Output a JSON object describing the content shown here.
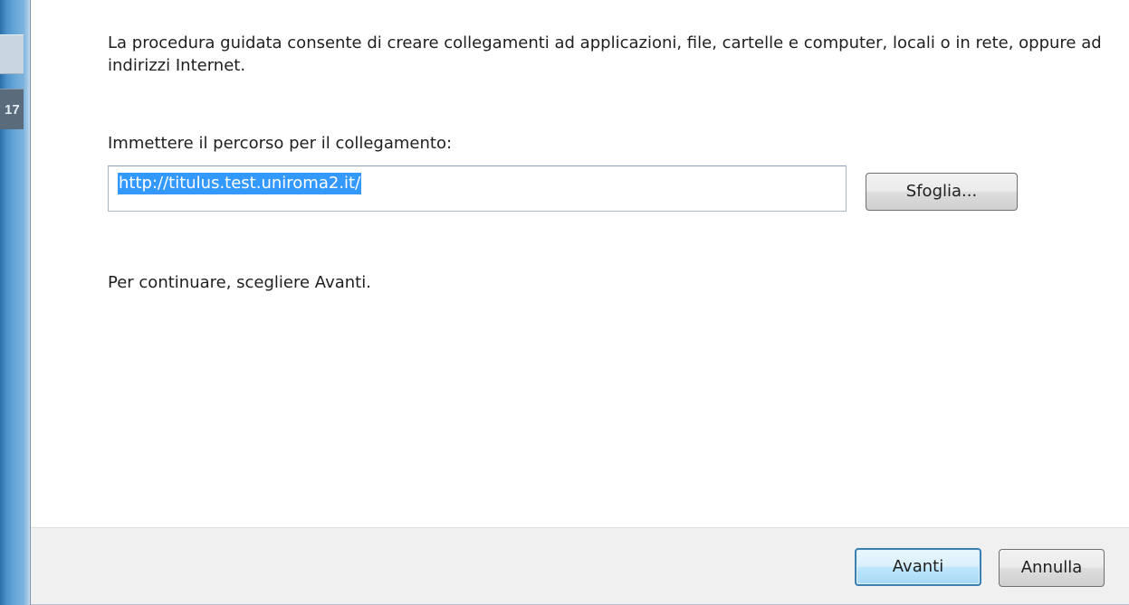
{
  "dialog": {
    "intro_text": "La procedura guidata consente di creare collegamenti ad applicazioni, file, cartelle e computer, locali o in rete, oppure ad indirizzi Internet.",
    "path_label": "Immettere il percorso per il collegamento:",
    "path_value": "http://titulus.test.uniroma2.it/",
    "browse_label": "Sfoglia...",
    "continue_text": "Per continuare, scegliere Avanti."
  },
  "footer": {
    "next_label": "Avanti",
    "cancel_label": "Annulla"
  },
  "background_window": {
    "partial_text": "17"
  },
  "colors": {
    "selection": "#3399ff",
    "default_button_border": "#3c7fb1",
    "footer_background": "#f0f0f0"
  }
}
